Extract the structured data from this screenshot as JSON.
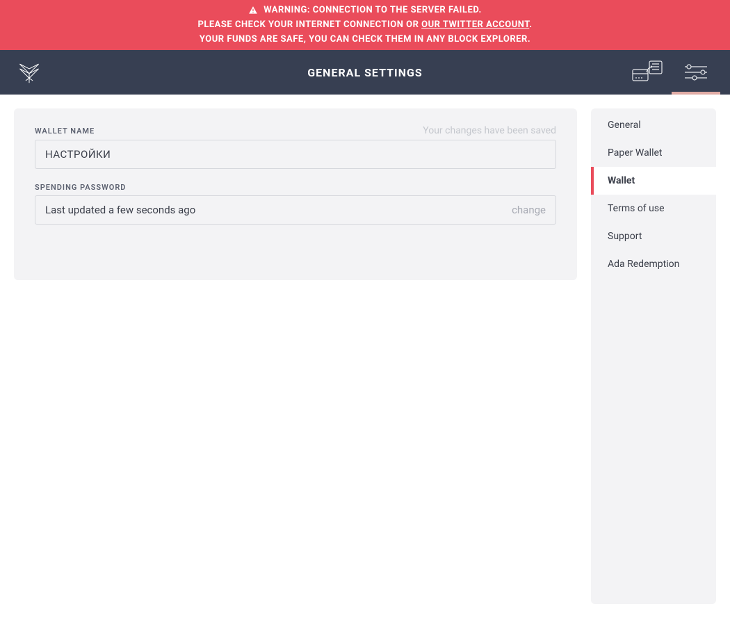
{
  "warning": {
    "line1": "WARNING: CONNECTION TO THE SERVER FAILED.",
    "line2_pre": "PLEASE CHECK YOUR INTERNET CONNECTION OR ",
    "line2_link": "OUR TWITTER ACCOUNT",
    "line2_post": ".",
    "line3": "YOUR FUNDS ARE SAFE, YOU CAN CHECK THEM IN ANY BLOCK EXPLORER."
  },
  "header": {
    "title": "GENERAL SETTINGS"
  },
  "settings": {
    "wallet_name": {
      "label": "WALLET NAME",
      "saved_msg": "Your changes have been saved",
      "value": "НАСТРОЙКИ"
    },
    "spending_password": {
      "label": "SPENDING PASSWORD",
      "status": "Last updated a few seconds ago",
      "change_label": "change"
    }
  },
  "sidebar": {
    "items": [
      {
        "label": "General",
        "active": false
      },
      {
        "label": "Paper Wallet",
        "active": false
      },
      {
        "label": "Wallet",
        "active": true
      },
      {
        "label": "Terms of use",
        "active": false
      },
      {
        "label": "Support",
        "active": false
      },
      {
        "label": "Ada Redemption",
        "active": false
      }
    ]
  }
}
